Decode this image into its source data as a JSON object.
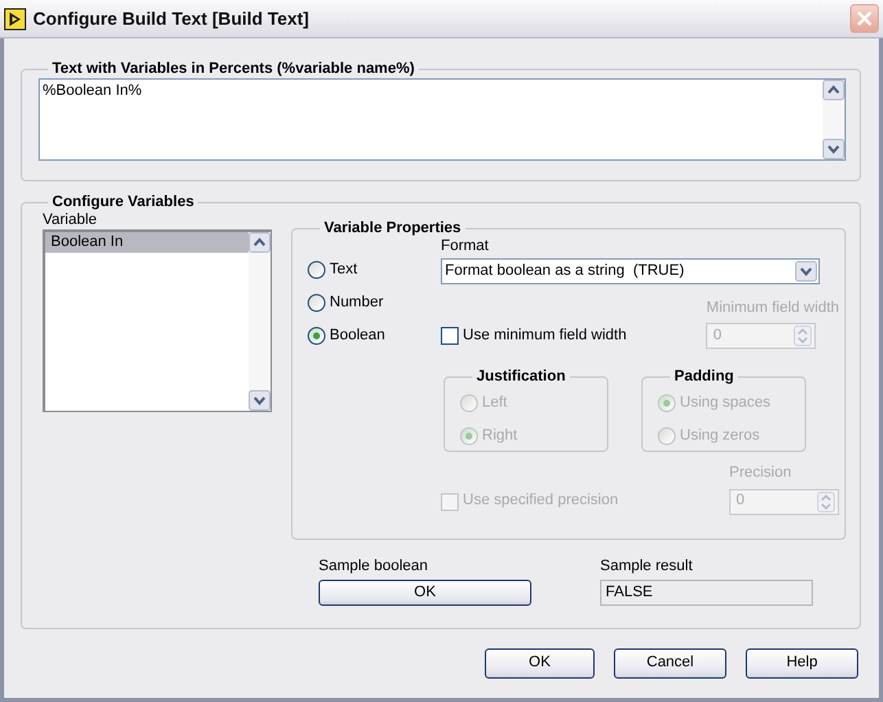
{
  "window": {
    "title": "Configure Build Text [Build Text]"
  },
  "text_group": {
    "legend": "Text with Variables in Percents (%variable name%)",
    "value": "%Boolean In%"
  },
  "variables_group": {
    "legend": "Configure Variables",
    "list_label": "Variable",
    "items": [
      {
        "label": "Boolean In",
        "selected": true
      }
    ]
  },
  "properties": {
    "legend": "Variable Properties",
    "types": [
      {
        "label": "Text",
        "selected": false
      },
      {
        "label": "Number",
        "selected": false
      },
      {
        "label": "Boolean",
        "selected": true
      }
    ],
    "format_label": "Format",
    "format_value": "Format boolean as a string  (TRUE)",
    "min_width_check": {
      "label": "Use minimum field width",
      "checked": false,
      "disabled": false
    },
    "min_width_field": {
      "label": "Minimum field width",
      "value": "0",
      "disabled": true
    },
    "justification": {
      "legend": "Justification",
      "disabled": true,
      "options": [
        {
          "label": "Left",
          "selected": false
        },
        {
          "label": "Right",
          "selected": true
        }
      ]
    },
    "padding": {
      "legend": "Padding",
      "disabled": true,
      "options": [
        {
          "label": "Using spaces",
          "selected": true
        },
        {
          "label": "Using zeros",
          "selected": false
        }
      ]
    },
    "precision_check": {
      "label": "Use specified precision",
      "checked": false,
      "disabled": true
    },
    "precision_field": {
      "label": "Precision",
      "value": "0",
      "disabled": true
    }
  },
  "sample": {
    "input_label": "Sample boolean",
    "button": "OK",
    "result_label": "Sample result",
    "result": "FALSE"
  },
  "buttons": [
    "OK",
    "Cancel",
    "Help"
  ]
}
